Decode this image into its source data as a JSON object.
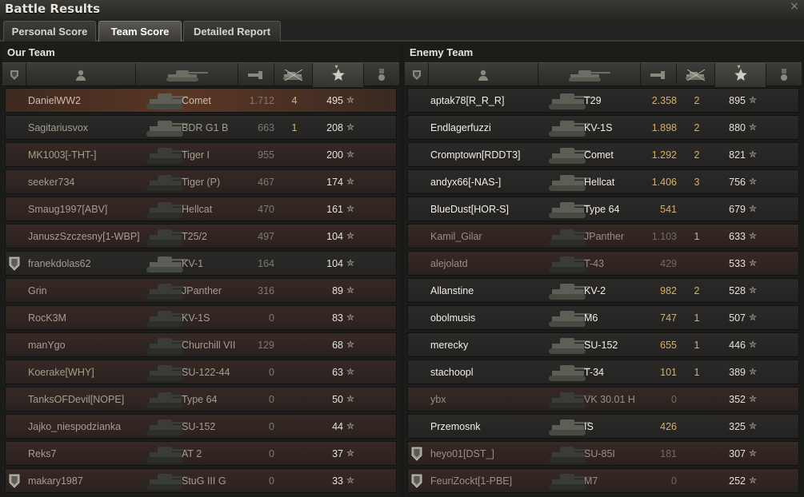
{
  "window": {
    "title": "Battle Results",
    "close_glyph": "×"
  },
  "tabs": [
    {
      "label": "Personal Score",
      "active": false
    },
    {
      "label": "Team Score",
      "active": true
    },
    {
      "label": "Detailed Report",
      "active": false
    }
  ],
  "columns": [
    "medal",
    "player",
    "vehicle",
    "damage",
    "kills",
    "experience",
    "achievements"
  ],
  "sort": {
    "column": "experience",
    "direction": "desc",
    "glyph": "▾"
  },
  "star_glyph": "✮",
  "our_team": {
    "title": "Our Team",
    "rows": [
      {
        "name": "DanielWW2",
        "tank": "Comet",
        "damage": "1.712",
        "kills": "4",
        "xp": "495",
        "badge": false,
        "state": "me"
      },
      {
        "name": "Sagitariusvox",
        "tank": "BDR G1 B",
        "damage": "663",
        "kills": "1",
        "xp": "208",
        "badge": false,
        "state": "alive"
      },
      {
        "name": "MK1003[-THT-]",
        "tank": "Tiger I",
        "damage": "955",
        "kills": "",
        "xp": "200",
        "badge": false,
        "state": "dead"
      },
      {
        "name": "seeker734",
        "tank": "Tiger (P)",
        "damage": "467",
        "kills": "",
        "xp": "174",
        "badge": false,
        "state": "dead"
      },
      {
        "name": "Smaug1997[ABV]",
        "tank": "Hellcat",
        "damage": "470",
        "kills": "",
        "xp": "161",
        "badge": false,
        "state": "dead"
      },
      {
        "name": "JanuszSzczesny[1-WBP]",
        "tank": "T25/2",
        "damage": "497",
        "kills": "",
        "xp": "104",
        "badge": false,
        "state": "dead"
      },
      {
        "name": "franekdolas62",
        "tank": "KV-1",
        "damage": "164",
        "kills": "",
        "xp": "104",
        "badge": true,
        "state": "alive"
      },
      {
        "name": "Grin",
        "tank": "JPanther",
        "damage": "316",
        "kills": "",
        "xp": "89",
        "badge": false,
        "state": "dead"
      },
      {
        "name": "RocK3M",
        "tank": "KV-1S",
        "damage": "0",
        "kills": "",
        "xp": "83",
        "badge": false,
        "state": "dead"
      },
      {
        "name": "manYgo",
        "tank": "Churchill VII",
        "damage": "129",
        "kills": "",
        "xp": "68",
        "badge": false,
        "state": "dead"
      },
      {
        "name": "Koerake[WHY]",
        "tank": "SU-122-44",
        "damage": "0",
        "kills": "",
        "xp": "63",
        "badge": false,
        "state": "dead"
      },
      {
        "name": "TanksOFDevil[NOPE]",
        "tank": "Type 64",
        "damage": "0",
        "kills": "",
        "xp": "50",
        "badge": false,
        "state": "dead"
      },
      {
        "name": "Jajko_niespodzianka",
        "tank": "SU-152",
        "damage": "0",
        "kills": "",
        "xp": "44",
        "badge": false,
        "state": "dead"
      },
      {
        "name": "Reks7",
        "tank": "AT 2",
        "damage": "0",
        "kills": "",
        "xp": "37",
        "badge": false,
        "state": "dead"
      },
      {
        "name": "makary1987",
        "tank": "StuG III G",
        "damage": "0",
        "kills": "",
        "xp": "33",
        "badge": true,
        "state": "dead"
      }
    ]
  },
  "enemy_team": {
    "title": "Enemy Team",
    "rows": [
      {
        "name": "aptak78[R_R_R]",
        "tank": "T29",
        "damage": "2.358",
        "kills": "2",
        "xp": "895",
        "badge": false,
        "state": "alive"
      },
      {
        "name": "Endlagerfuzzi",
        "tank": "KV-1S",
        "damage": "1.898",
        "kills": "2",
        "xp": "880",
        "badge": false,
        "state": "alive"
      },
      {
        "name": "Cromptown[RDDT3]",
        "tank": "Comet",
        "damage": "1.292",
        "kills": "2",
        "xp": "821",
        "badge": false,
        "state": "alive"
      },
      {
        "name": "andyx66[-NAS-]",
        "tank": "Hellcat",
        "damage": "1.406",
        "kills": "3",
        "xp": "756",
        "badge": false,
        "state": "alive"
      },
      {
        "name": "BlueDust[HOR-S]",
        "tank": "Type 64",
        "damage": "541",
        "kills": "",
        "xp": "679",
        "badge": false,
        "state": "alive"
      },
      {
        "name": "Kamil_Gilar",
        "tank": "JPanther",
        "damage": "1.103",
        "kills": "1",
        "xp": "633",
        "badge": false,
        "state": "dead"
      },
      {
        "name": "alejolatd",
        "tank": "T-43",
        "damage": "429",
        "kills": "",
        "xp": "533",
        "badge": false,
        "state": "dead"
      },
      {
        "name": "Allanstine",
        "tank": "KV-2",
        "damage": "982",
        "kills": "2",
        "xp": "528",
        "badge": false,
        "state": "alive"
      },
      {
        "name": "obolmusis",
        "tank": "M6",
        "damage": "747",
        "kills": "1",
        "xp": "507",
        "badge": false,
        "state": "alive"
      },
      {
        "name": "merecky",
        "tank": "SU-152",
        "damage": "655",
        "kills": "1",
        "xp": "446",
        "badge": false,
        "state": "alive"
      },
      {
        "name": "stachoopl",
        "tank": "T-34",
        "damage": "101",
        "kills": "1",
        "xp": "389",
        "badge": false,
        "state": "alive"
      },
      {
        "name": "ybx",
        "tank": "VK 30.01 H",
        "damage": "0",
        "kills": "",
        "xp": "352",
        "badge": false,
        "state": "dead"
      },
      {
        "name": "Przemosnk",
        "tank": "IS",
        "damage": "426",
        "kills": "",
        "xp": "325",
        "badge": false,
        "state": "alive"
      },
      {
        "name": "heyo01[DST_]",
        "tank": "SU-85I",
        "damage": "181",
        "kills": "",
        "xp": "307",
        "badge": true,
        "state": "dead"
      },
      {
        "name": "FeuriZockt[1-PBE]",
        "tank": "M7",
        "damage": "0",
        "kills": "",
        "xp": "252",
        "badge": true,
        "state": "dead"
      }
    ]
  }
}
